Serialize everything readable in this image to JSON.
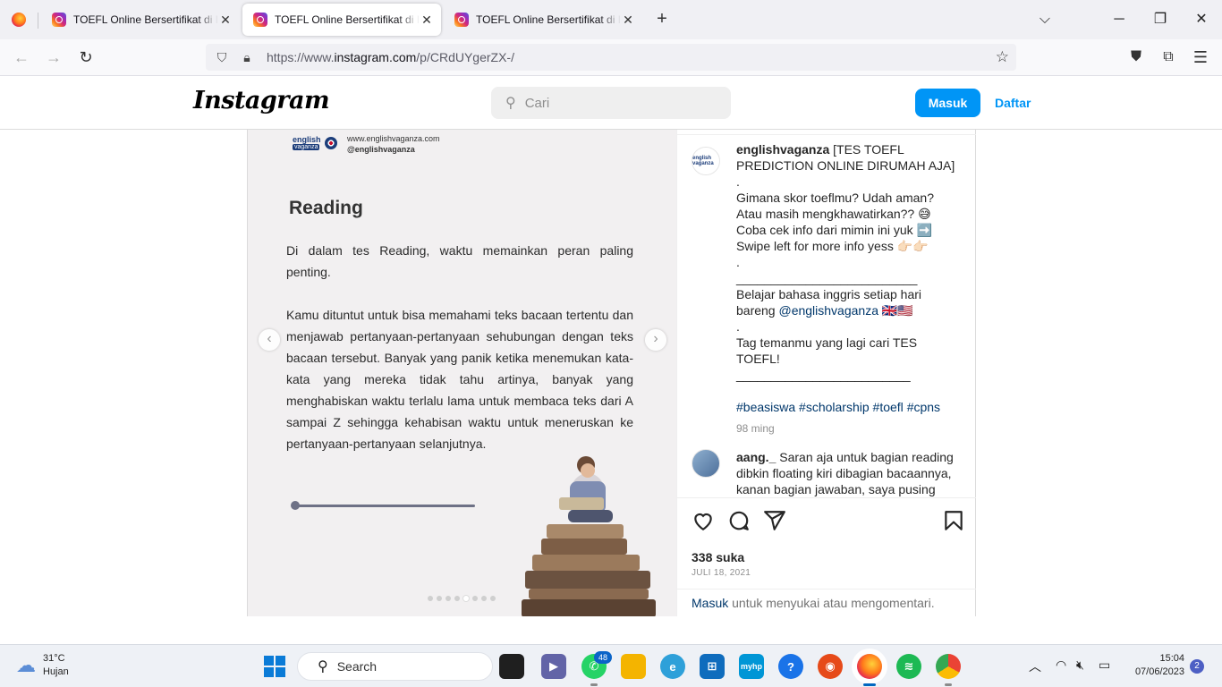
{
  "browser": {
    "tabs": [
      {
        "title": "TOEFL Online Bersertifikat di Ins",
        "active": false
      },
      {
        "title": "TOEFL Online Bersertifikat di Ins",
        "active": true
      },
      {
        "title": "TOEFL Online Bersertifikat di Ins",
        "active": false
      }
    ],
    "new_tab": "+",
    "url_prefix": "https://www.",
    "url_domain": "instagram.com",
    "url_path": "/p/CRdUYgerZX-/"
  },
  "instagram": {
    "logo": "Instagram",
    "search_placeholder": "Cari",
    "login_label": "Masuk",
    "signup_label": "Daftar"
  },
  "slide": {
    "brand_top": "english",
    "brand_bottom": "vaganza",
    "website": "www.englishvaganza.com",
    "handle": "@englishvaganza",
    "title": "Reading",
    "paragraph1": "Di dalam tes Reading, waktu memainkan peran paling penting.",
    "paragraph2": "Kamu dituntut untuk bisa memahami teks bacaan tertentu dan menjawab pertanyaan-pertanyaan sehubungan dengan teks bacaan tersebut. Banyak yang panik ketika menemukan kata-kata yang mereka tidak tahu artinya, banyak yang menghabiskan waktu terlalu lama untuk membaca teks dari A sampai Z sehingga kehabisan waktu untuk meneruskan ke pertanyaan-pertanyaan selanjutnya.",
    "prev": "‹",
    "next": "›",
    "dot_count": 8,
    "active_dot": 4
  },
  "post": {
    "author": "englishvaganza",
    "avatar_text": "english vaganza",
    "caption_first": "[TES TOEFL PREDICTION ONLINE DIRUMAH AJA]",
    "caption_lines": [
      ".",
      "Gimana skor toeflmu? Udah aman?",
      "Atau masih mengkhawatirkan?? 😅",
      "Coba cek info dari mimin ini yuk ➡️",
      "Swipe left for more info yess 👉🏻👉🏻",
      ".",
      "__________________________",
      "Belajar bahasa inggris setiap hari"
    ],
    "caption_mention_prefix": "bareng ",
    "caption_mention": "@englishvaganza",
    "caption_mention_suffix": " 🇬🇧🇺🇸",
    "caption_lines2": [
      ".",
      "Tag temanmu yang lagi cari TES TOEFL!",
      "_________________________"
    ],
    "hashtags": [
      "#beasiswa",
      "#scholarship",
      "#toefl",
      "#cpns"
    ],
    "time": "98 ming",
    "comment_user": "aang._",
    "comment_text": "Saran aja untuk bagian reading dibkin floating kiri dibagian bacaannya, kanan bagian jawaban, saya pusing scroll",
    "likes": "338 suka",
    "date": "JULI 18, 2021",
    "login_link": "Masuk",
    "login_text": " untuk menyukai atau mengomentari."
  },
  "taskbar": {
    "temp": "31°C",
    "weather": "Hujan",
    "search": "Search",
    "whatsapp_badge": "48",
    "time": "15:04",
    "date": "07/06/2023",
    "notifications": "2"
  },
  "colors": {
    "ig_blue": "#0095f6",
    "link": "#00376b",
    "slide_bg": "#f2f0f1"
  }
}
